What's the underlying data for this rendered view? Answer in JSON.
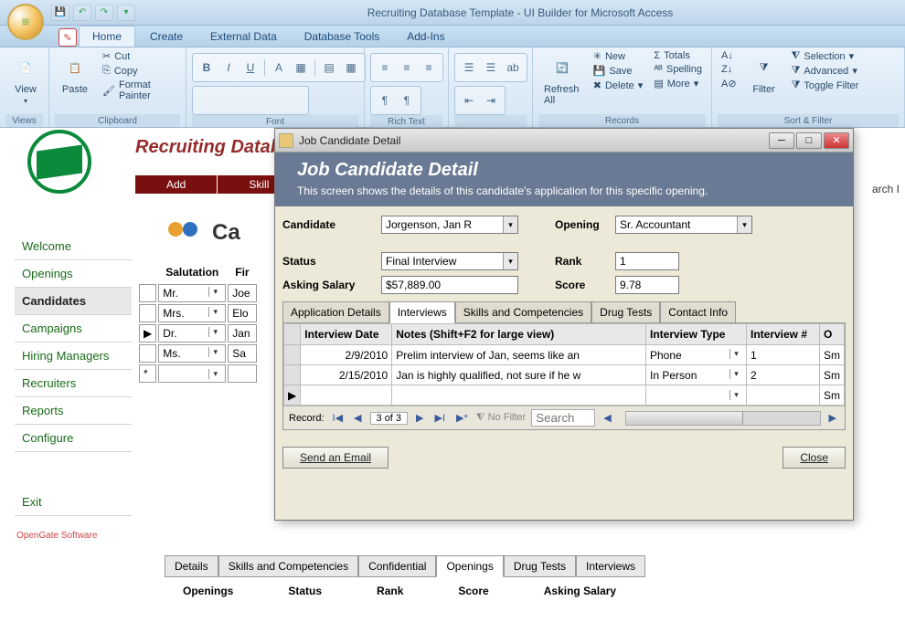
{
  "window": {
    "title": "Recruiting Database Template - UI Builder for Microsoft Access"
  },
  "ribbon": {
    "tabs": [
      "Home",
      "Create",
      "External Data",
      "Database Tools",
      "Add-Ins"
    ],
    "active_tab": "Home",
    "groups": {
      "views": {
        "label": "Views",
        "view_btn": "View"
      },
      "clipboard": {
        "label": "Clipboard",
        "paste": "Paste",
        "cut": "Cut",
        "copy": "Copy",
        "format_painter": "Format Painter"
      },
      "font": {
        "label": "Font"
      },
      "richtext": {
        "label": "Rich Text"
      },
      "records": {
        "label": "Records",
        "refresh": "Refresh All",
        "new": "New",
        "save": "Save",
        "delete": "Delete",
        "totals": "Totals",
        "spelling": "Spelling",
        "more": "More"
      },
      "sortfilter": {
        "label": "Sort & Filter",
        "filter": "Filter",
        "selection": "Selection",
        "advanced": "Advanced",
        "toggle": "Toggle Filter"
      }
    }
  },
  "app": {
    "title": "Recruiting Databa",
    "toolbar": {
      "add": "Add",
      "skill": "Skill"
    }
  },
  "sidebar": {
    "items": [
      "Welcome",
      "Openings",
      "Candidates",
      "Campaigns",
      "Hiring Managers",
      "Recruiters",
      "Reports",
      "Configure"
    ],
    "exit": "Exit",
    "active": "Candidates",
    "footer": "OpenGate Software"
  },
  "content": {
    "heading": "Ca",
    "columns": {
      "salutation": "Salutation",
      "first": "Fir"
    },
    "rows": [
      {
        "sal": "Mr.",
        "first": "Joe"
      },
      {
        "sal": "Mrs.",
        "first": "Elo"
      },
      {
        "sal": "Dr.",
        "first": "Jan"
      },
      {
        "sal": "Ms.",
        "first": "Sa"
      }
    ]
  },
  "lower_tabs": {
    "tabs": [
      "Details",
      "Skills and Competencies",
      "Confidential",
      "Openings",
      "Drug Tests",
      "Interviews"
    ],
    "active": "Openings",
    "headers": [
      "Openings",
      "Status",
      "Rank",
      "Score",
      "Asking Salary"
    ]
  },
  "dialog": {
    "window_title": "Job Candidate Detail",
    "header_title": "Job Candidate Detail",
    "header_sub": "This screen shows the details of this candidate's application for this specific opening.",
    "fields": {
      "candidate_label": "Candidate",
      "candidate_value": "Jorgenson, Jan R",
      "opening_label": "Opening",
      "opening_value": "Sr. Accountant",
      "status_label": "Status",
      "status_value": "Final Interview",
      "rank_label": "Rank",
      "rank_value": "1",
      "asking_label": "Asking Salary",
      "asking_value": "$57,889.00",
      "score_label": "Score",
      "score_value": "9.78"
    },
    "tabs": [
      "Application Details",
      "Interviews",
      "Skills and Competencies",
      "Drug Tests",
      "Contact Info"
    ],
    "active_tab": "Interviews",
    "grid": {
      "headers": {
        "date": "Interview Date",
        "notes": "Notes (Shift+F2 for large view)",
        "type": "Interview Type",
        "num": "Interview #",
        "o": "O"
      },
      "rows": [
        {
          "date": "2/9/2010",
          "notes": "Prelim interview of Jan, seems like an",
          "type": "Phone",
          "num": "1",
          "o": "Sm"
        },
        {
          "date": "2/15/2010",
          "notes": "Jan is highly qualified, not sure if he w",
          "type": "In Person",
          "num": "2",
          "o": "Sm"
        },
        {
          "date": "",
          "notes": "",
          "type": "",
          "num": "",
          "o": "Sm"
        }
      ]
    },
    "recordnav": {
      "label": "Record:",
      "pos": "3 of 3",
      "nofilter": "No Filter",
      "search": "Search"
    },
    "footer": {
      "send": "Send an Email",
      "close": "Close"
    }
  }
}
